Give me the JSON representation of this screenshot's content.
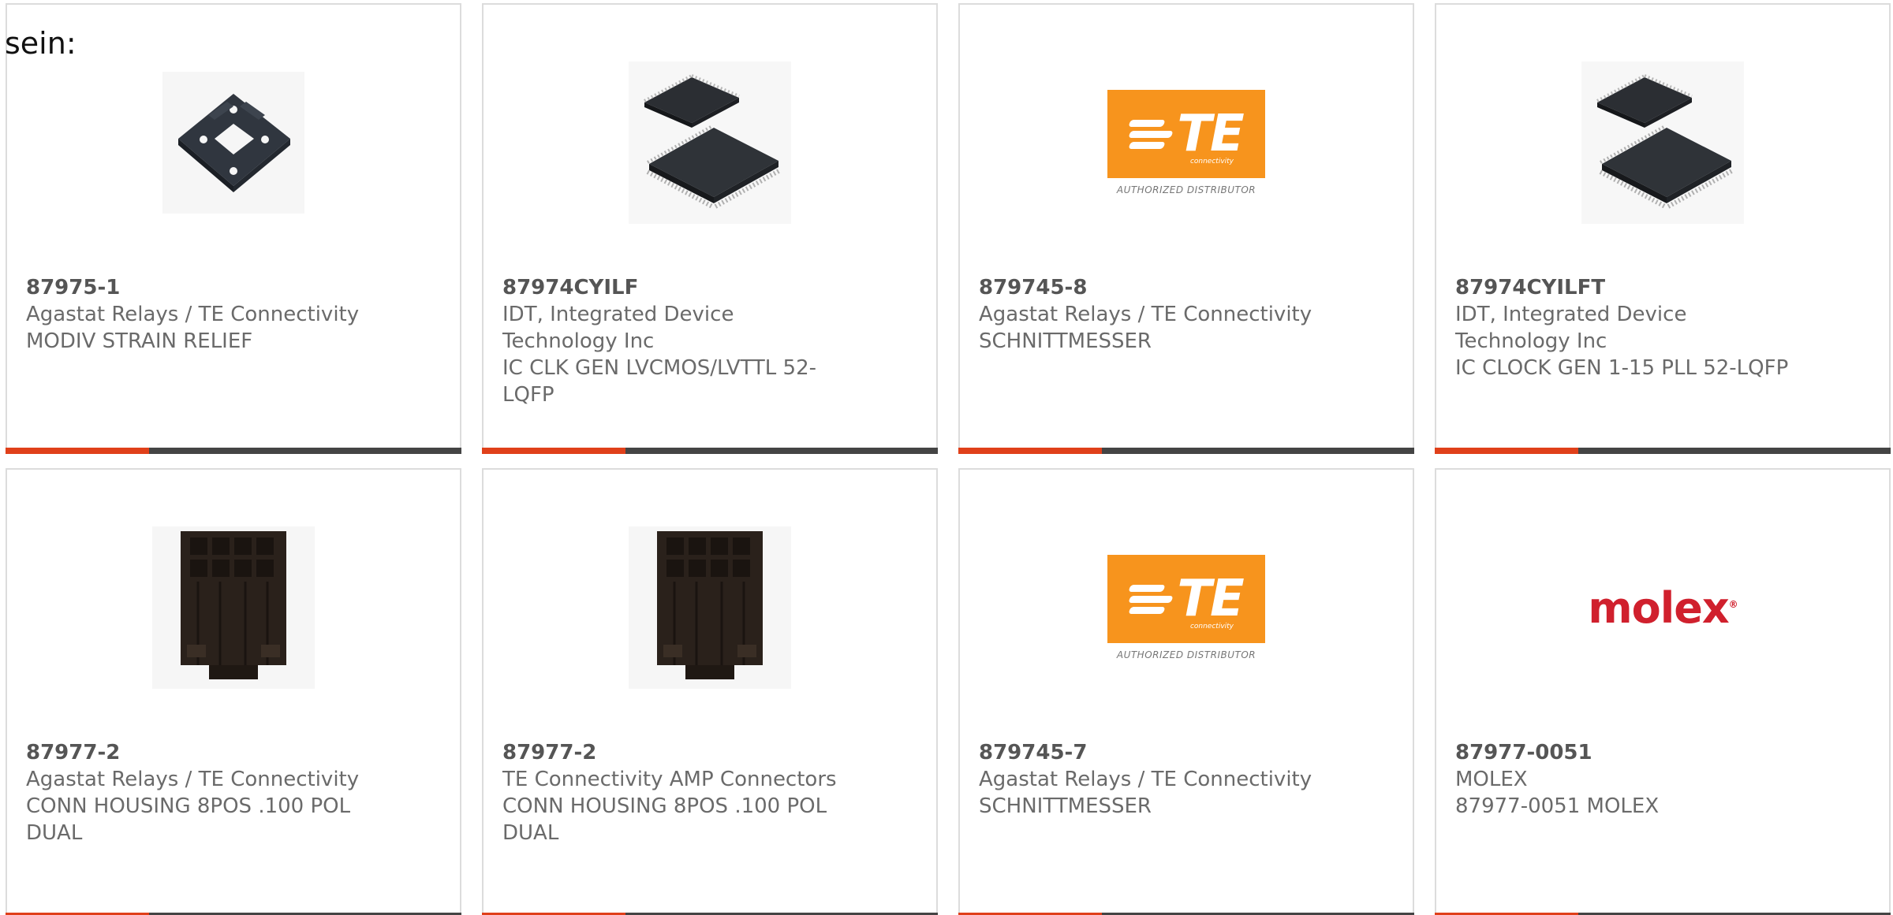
{
  "intro_text": "sein:",
  "colors": {
    "accent": "#e0401a",
    "bar": "#444444",
    "te_orange": "#f7941d",
    "molex_red": "#d0202d"
  },
  "products": [
    {
      "part_number": "87975-1",
      "manufacturer": "Agastat Relays / TE Connectivity",
      "description": "MODIV STRAIN RELIEF",
      "image": "strain-relief-photo"
    },
    {
      "part_number": "87974CYILF",
      "manufacturer": "IDT, Integrated Device Technology Inc",
      "description": "IC CLK GEN LVCMOS/LVTTL 52-LQFP",
      "image": "lqfp-chip-photo"
    },
    {
      "part_number": "879745-8",
      "manufacturer": "Agastat Relays / TE Connectivity",
      "description": "SCHNITTMESSER",
      "image": "te-connectivity-logo"
    },
    {
      "part_number": "87974CYILFT",
      "manufacturer": "IDT, Integrated Device Technology Inc",
      "description": "IC CLOCK GEN 1-15 PLL 52-LQFP",
      "image": "lqfp-chip-photo"
    },
    {
      "part_number": "87977-2",
      "manufacturer": "Agastat Relays / TE Connectivity",
      "description": "CONN HOUSING 8POS .100 POL DUAL",
      "image": "connector-housing-photo"
    },
    {
      "part_number": "87977-2",
      "manufacturer": "TE Connectivity AMP Connectors",
      "description": "CONN HOUSING 8POS .100 POL DUAL",
      "image": "connector-housing-photo"
    },
    {
      "part_number": "879745-7",
      "manufacturer": "Agastat Relays / TE Connectivity",
      "description": "SCHNITTMESSER",
      "image": "te-connectivity-logo"
    },
    {
      "part_number": "87977-0051",
      "manufacturer": "MOLEX",
      "description": "87977-0051 MOLEX",
      "image": "molex-logo"
    }
  ],
  "logos": {
    "te_text": "TE",
    "te_sub": "connectivity",
    "te_auth": "AUTHORIZED DISTRIBUTOR",
    "molex_text": "molex"
  }
}
